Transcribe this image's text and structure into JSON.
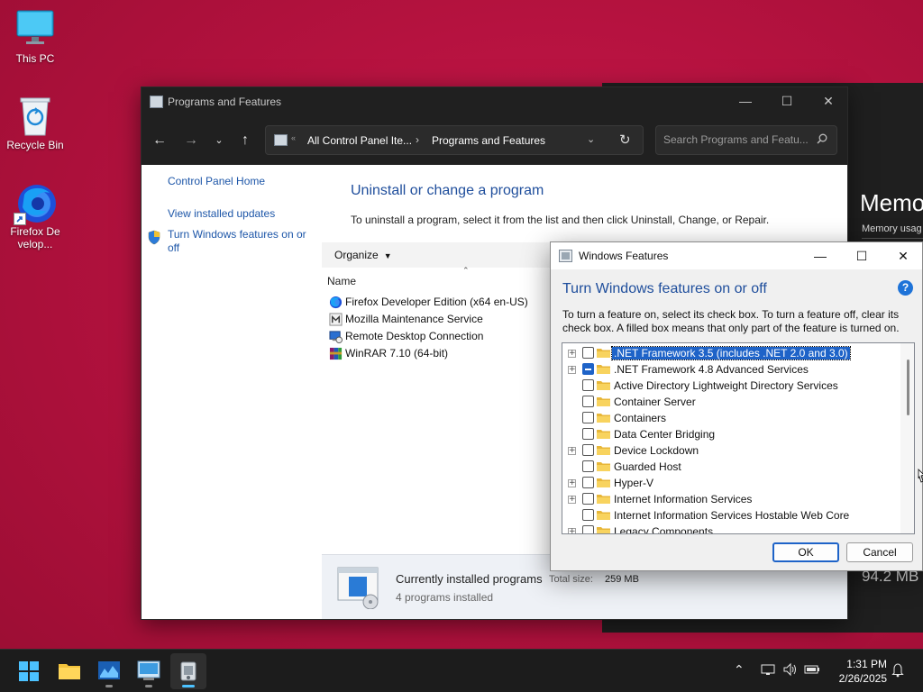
{
  "desktop": {
    "icons": [
      {
        "label": "This PC",
        "icon": "monitor-icon"
      },
      {
        "label": "Recycle Bin",
        "icon": "recycle-bin-icon"
      },
      {
        "label": "Firefox Develop...",
        "icon": "firefox-developer-icon"
      }
    ],
    "background_color": "#b5123f"
  },
  "background_window": {
    "title": "Memo",
    "subtitle": "Memory usag",
    "value": "94.2 MB"
  },
  "programs_window": {
    "title": "Programs and Features",
    "breadcrumb": [
      "All Control Panel Ite...",
      "Programs and Features"
    ],
    "search_placeholder": "Search Programs and Featu...",
    "left_links": [
      "Control Panel Home",
      "View installed updates",
      "Turn Windows features on or off"
    ],
    "heading": "Uninstall or change a program",
    "description": "To uninstall a program, select it from the list and then click Uninstall, Change, or Repair.",
    "toolbar": {
      "organize_label": "Organize"
    },
    "column_name": "Name",
    "programs": [
      {
        "name": "Firefox Developer Edition (x64 en-US)",
        "icon": "firefox-icon"
      },
      {
        "name": "Mozilla Maintenance Service",
        "icon": "mozilla-icon"
      },
      {
        "name": "Remote Desktop Connection",
        "icon": "remote-desktop-icon"
      },
      {
        "name": "WinRAR 7.10 (64-bit)",
        "icon": "winrar-icon"
      }
    ],
    "status": {
      "title": "Currently installed programs",
      "count": "4 programs installed",
      "total_label": "Total size:",
      "total_value": "259 MB"
    }
  },
  "features_dialog": {
    "title": "Windows Features",
    "heading": "Turn Windows features on or off",
    "description": "To turn a feature on, select its check box. To turn a feature off, clear its check box. A filled box means that only part of the feature is turned on.",
    "features": [
      {
        "label": ".NET Framework 3.5 (includes .NET 2.0 and 3.0)",
        "expandable": true,
        "state": "unchecked",
        "selected": true
      },
      {
        "label": ".NET Framework 4.8 Advanced Services",
        "expandable": true,
        "state": "partial",
        "selected": false
      },
      {
        "label": "Active Directory Lightweight Directory Services",
        "expandable": false,
        "state": "unchecked",
        "selected": false
      },
      {
        "label": "Container Server",
        "expandable": false,
        "state": "unchecked",
        "selected": false
      },
      {
        "label": "Containers",
        "expandable": false,
        "state": "unchecked",
        "selected": false
      },
      {
        "label": "Data Center Bridging",
        "expandable": false,
        "state": "unchecked",
        "selected": false
      },
      {
        "label": "Device Lockdown",
        "expandable": true,
        "state": "unchecked",
        "selected": false
      },
      {
        "label": "Guarded Host",
        "expandable": false,
        "state": "unchecked",
        "selected": false
      },
      {
        "label": "Hyper-V",
        "expandable": true,
        "state": "unchecked",
        "selected": false
      },
      {
        "label": "Internet Information Services",
        "expandable": true,
        "state": "unchecked",
        "selected": false
      },
      {
        "label": "Internet Information Services Hostable Web Core",
        "expandable": false,
        "state": "unchecked",
        "selected": false
      },
      {
        "label": "Legacy Components",
        "expandable": true,
        "state": "unchecked",
        "selected": false
      }
    ],
    "ok_label": "OK",
    "cancel_label": "Cancel"
  },
  "taskbar": {
    "apps": [
      "start-icon",
      "file-explorer-icon",
      "task-manager-icon",
      "control-panel-icon",
      "programs-features-icon"
    ],
    "time": "1:31 PM",
    "date": "2/26/2025",
    "accent_color": "#4cc2ff"
  }
}
